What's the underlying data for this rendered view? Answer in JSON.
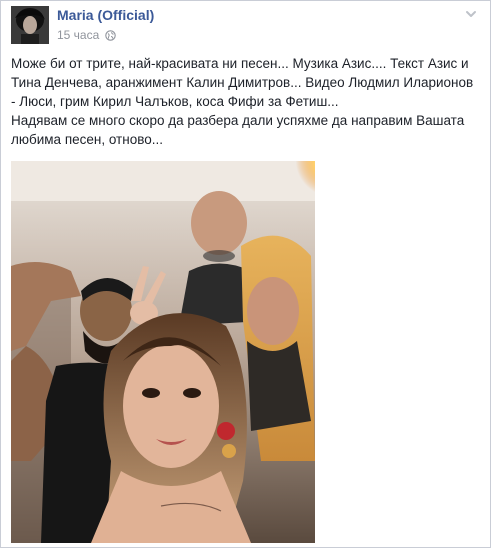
{
  "post": {
    "author": "Maria (Official)",
    "time": "15 часа",
    "text": "Може би от трите, най-красивата ни песен... Музика Азис.... Текст Азис и Тина Денчева, аранжимент Калин Димитров... Видео Людмил Иларионов - Люси, грим Кирил Чалъков, коса Фифи за Фетиш...\nНадявам се много скоро да разбера дали успяхме да направим Вашата любима песен, отново..."
  },
  "icons": {
    "avatar": "avatar",
    "audience": "globe-icon",
    "menu": "chevron-down-icon"
  }
}
